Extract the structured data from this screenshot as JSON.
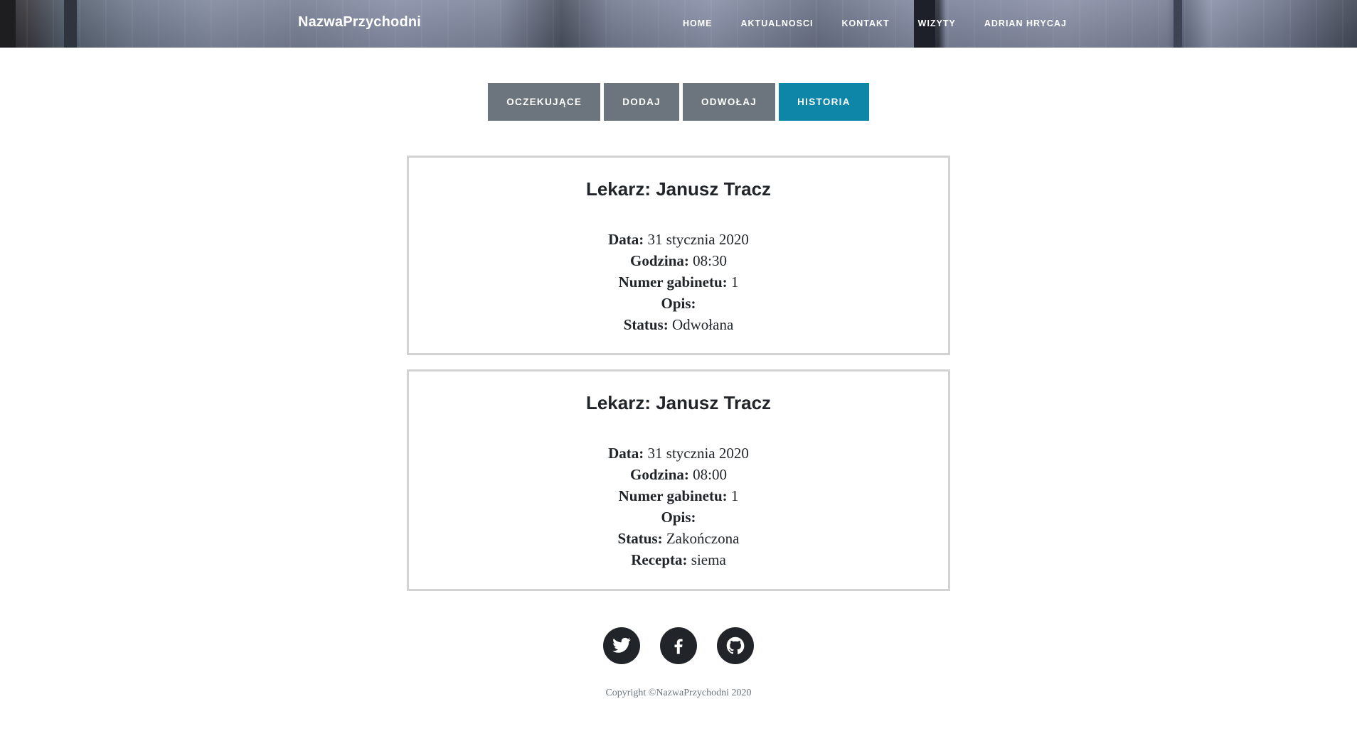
{
  "header": {
    "brand": "NazwaPrzychodni",
    "nav": [
      "HOME",
      "AKTUALNOSCI",
      "KONTAKT",
      "WIZYTY",
      "ADRIAN HRYCAJ"
    ]
  },
  "tabs": {
    "items": [
      "OCZEKUJĄCE",
      "DODAJ",
      "ODWOŁAJ",
      "HISTORIA"
    ],
    "active": "HISTORIA"
  },
  "visits": [
    {
      "title": "Lekarz: Janusz Tracz",
      "fields": [
        {
          "label": "Data:",
          "value": " 31 stycznia 2020"
        },
        {
          "label": "Godzina:",
          "value": " 08:30"
        },
        {
          "label": "Numer gabinetu:",
          "value": " 1"
        },
        {
          "label": "Opis:",
          "value": ""
        },
        {
          "label": "Status:",
          "value": " Odwołana"
        }
      ]
    },
    {
      "title": "Lekarz: Janusz Tracz",
      "fields": [
        {
          "label": "Data:",
          "value": " 31 stycznia 2020"
        },
        {
          "label": "Godzina:",
          "value": " 08:00"
        },
        {
          "label": "Numer gabinetu:",
          "value": " 1"
        },
        {
          "label": "Opis:",
          "value": ""
        },
        {
          "label": "Status:",
          "value": " Zakończona"
        },
        {
          "label": "Recepta:",
          "value": " siema"
        }
      ]
    }
  ],
  "footer": {
    "social": [
      "twitter-icon",
      "facebook-icon",
      "github-icon"
    ],
    "copyright": "Copyright ©NazwaPrzychodni 2020"
  },
  "colors": {
    "active_tab": "#0e86a8",
    "inactive_tab": "#6c757d",
    "social_bg": "#212529"
  }
}
